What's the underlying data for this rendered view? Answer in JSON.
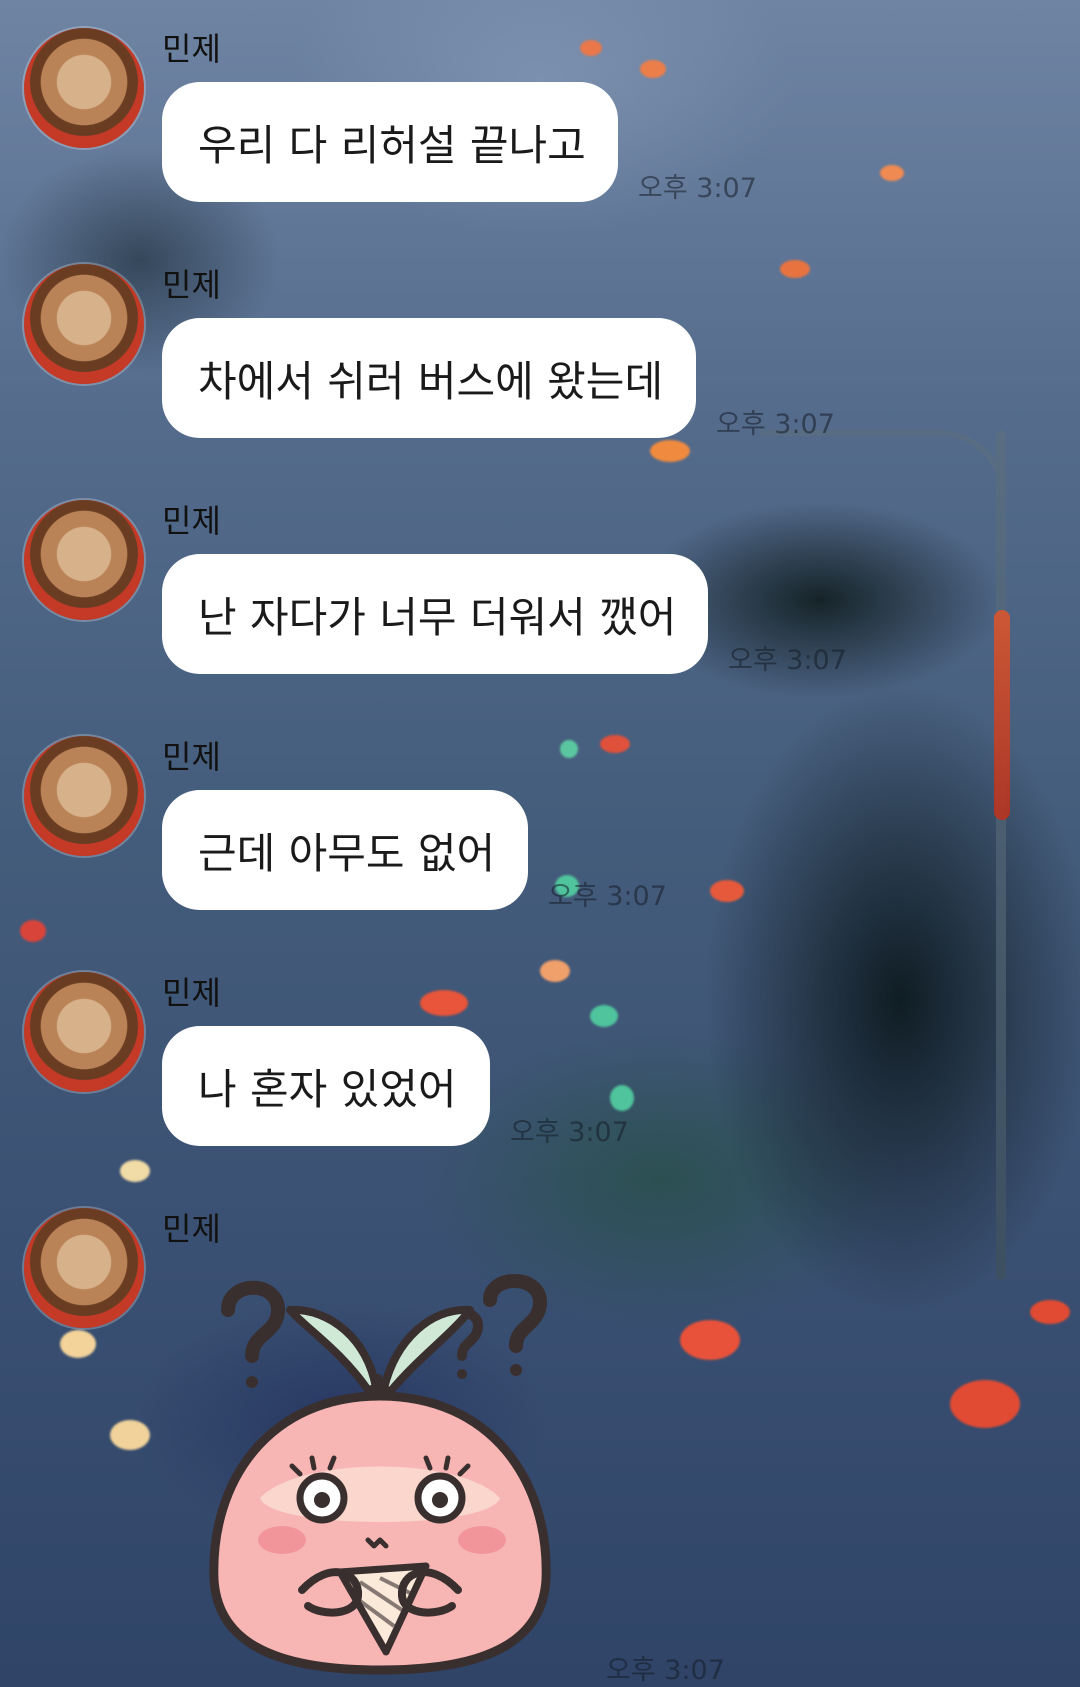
{
  "messages": [
    {
      "sender": "민제",
      "text": "우리 다 리허설 끝나고",
      "time": "오후 3:07"
    },
    {
      "sender": "민제",
      "text": "차에서 쉬러 버스에 왔는데",
      "time": "오후 3:07"
    },
    {
      "sender": "민제",
      "text": "난 자다가 너무 더워서 깼어",
      "time": "오후 3:07"
    },
    {
      "sender": "민제",
      "text": "근데 아무도 없어",
      "time": "오후 3:07"
    },
    {
      "sender": "민제",
      "text": "나 혼자 있었어",
      "time": "오후 3:07"
    }
  ],
  "last": {
    "sender": "민제",
    "sticker": "confused-peach-sticker",
    "time": "오후 3:07"
  },
  "colors": {
    "bubble": "#ffffff",
    "sticker_body": "#f7b6b3",
    "sticker_leaf": "#cfe9d6"
  }
}
